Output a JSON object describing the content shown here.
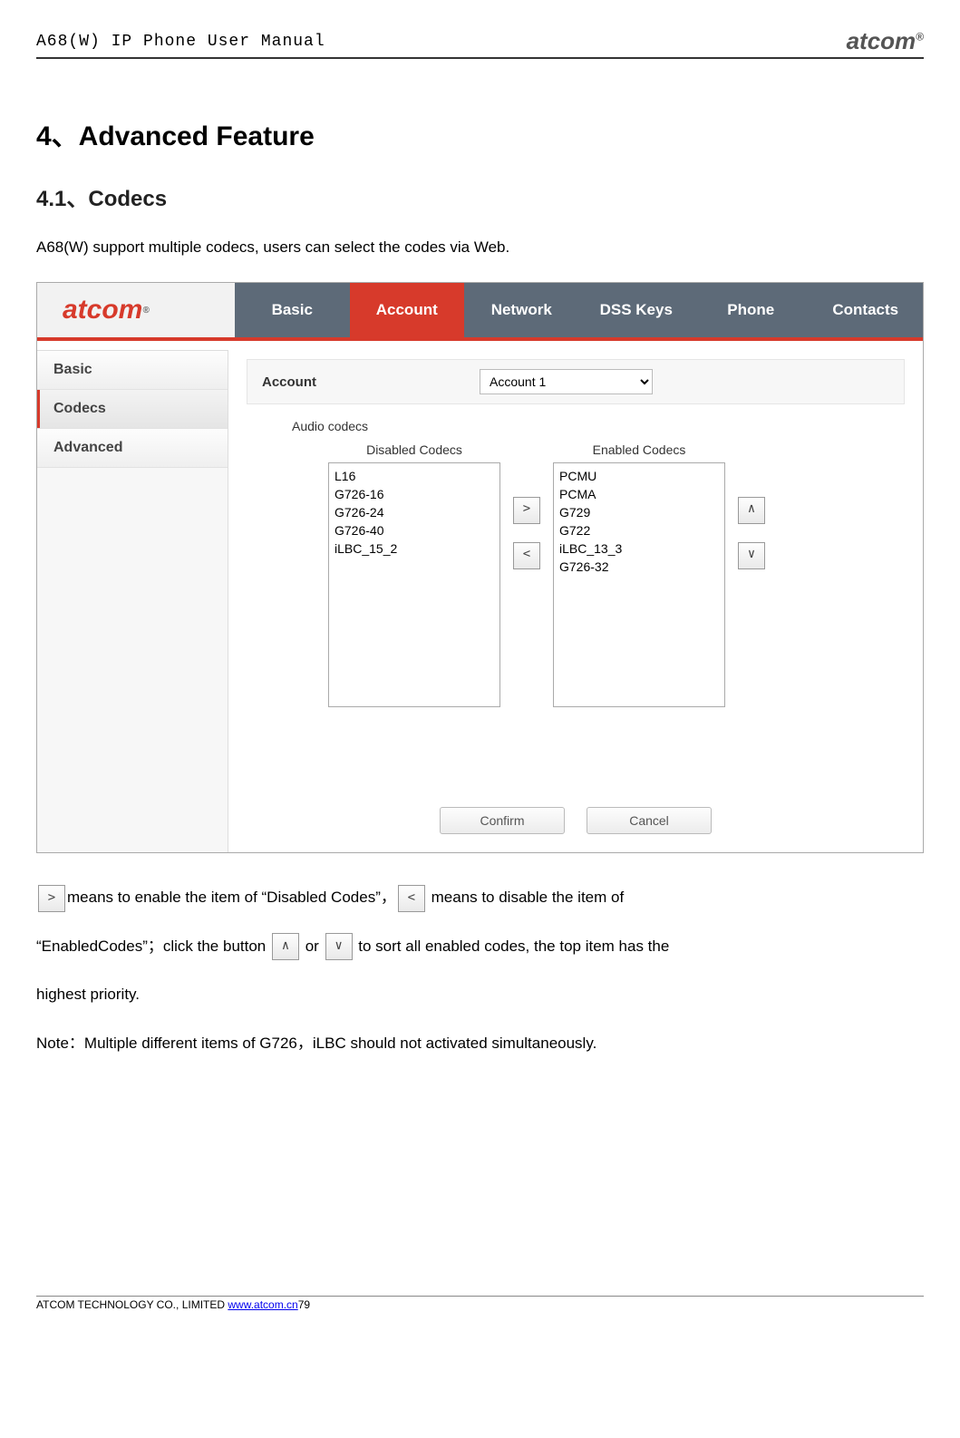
{
  "header": {
    "doc_title": "A68(W) IP Phone User Manual",
    "logo_text": "atcom",
    "logo_reg": "®"
  },
  "section": {
    "h1": "4、Advanced Feature",
    "h2": "4.1、Codecs",
    "intro": "A68(W) support multiple codecs, users can select the codes via Web."
  },
  "ui": {
    "brand": "atcom",
    "brand_reg": "®",
    "tabs": [
      "Basic",
      "Account",
      "Network",
      "DSS Keys",
      "Phone",
      "Contacts"
    ],
    "active_tab_index": 1,
    "sidebar": [
      "Basic",
      "Codecs",
      "Advanced"
    ],
    "active_side_index": 1,
    "account_label": "Account",
    "account_value": "Account 1",
    "audio_codecs_label": "Audio codecs",
    "disabled_header": "Disabled Codecs",
    "enabled_header": "Enabled Codecs",
    "disabled_list": [
      "L16",
      "G726-16",
      "G726-24",
      "G726-40",
      "iLBC_15_2"
    ],
    "enabled_list": [
      "PCMU",
      "PCMA",
      "G729",
      "G722",
      "iLBC_13_3",
      "G726-32"
    ],
    "btn_right": ">",
    "btn_left": "<",
    "btn_up": "∧",
    "btn_down": "∨",
    "confirm": "Confirm",
    "cancel": "Cancel"
  },
  "explain": {
    "p1a": "means to enable the item of “Disabled Codes”，",
    "p1b": " means to disable the item of",
    "p2a": "“EnabledCodes”；click the button ",
    "p2b": " or ",
    "p2c": " to sort all enabled codes, the top item has the",
    "p3": "highest priority.",
    "note": "Note：Multiple different items of G726，iLBC should not activated simultaneously."
  },
  "footer": {
    "company": "ATCOM TECHNOLOGY CO., LIMITED ",
    "link": "www.atcom.cn",
    "page": "79"
  }
}
